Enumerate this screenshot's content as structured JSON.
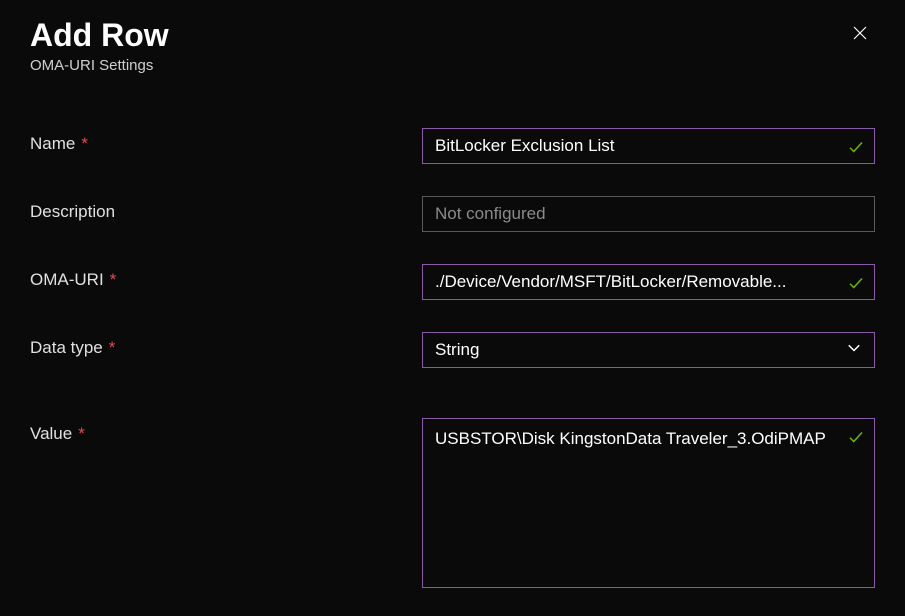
{
  "header": {
    "title": "Add Row",
    "subtitle": "OMA-URI Settings"
  },
  "fields": {
    "name": {
      "label": "Name",
      "required": true,
      "value": "BitLocker Exclusion List",
      "validated": true
    },
    "description": {
      "label": "Description",
      "required": false,
      "value": "",
      "placeholder": "Not configured",
      "validated": false
    },
    "omauri": {
      "label": "OMA-URI",
      "required": true,
      "value": "./Device/Vendor/MSFT/BitLocker/Removable...",
      "validated": true
    },
    "datatype": {
      "label": "Data type",
      "required": true,
      "value": "String"
    },
    "value": {
      "label": "Value",
      "required": true,
      "value": "USBSTOR\\Disk KingstonData Traveler_3.OdiPMAP",
      "validated": true
    }
  },
  "colors": {
    "accent": "#8a5aa8",
    "success": "#6bb700",
    "required": "#e74856"
  }
}
